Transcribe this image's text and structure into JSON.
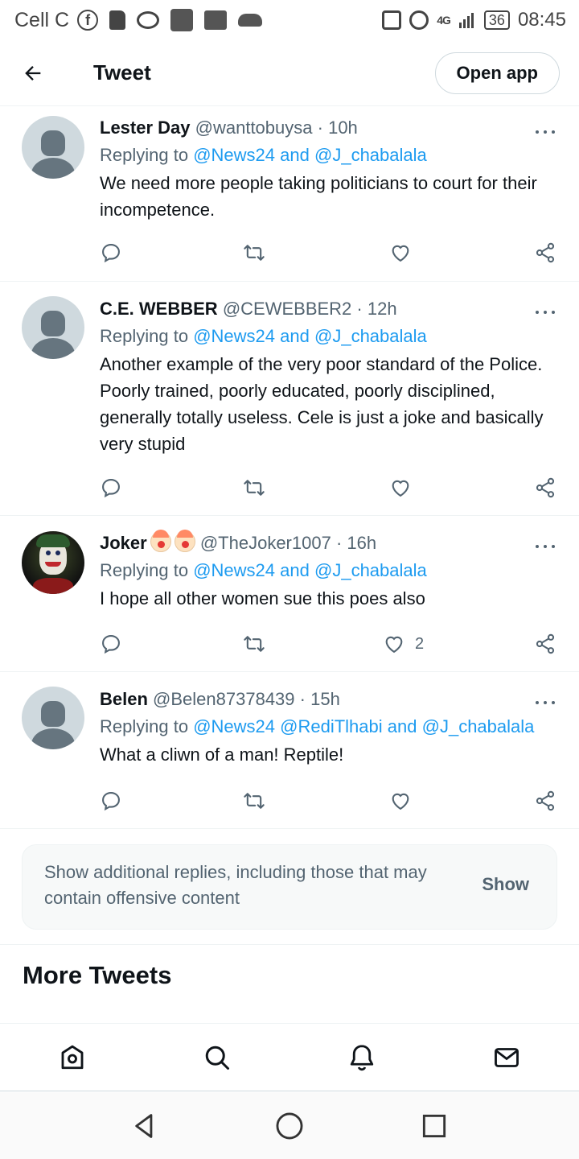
{
  "status_bar": {
    "carrier": "Cell C",
    "network": "4G",
    "battery": "36",
    "time": "08:45"
  },
  "header": {
    "title": "Tweet",
    "open_app_label": "Open app",
    "back_icon": "arrow-left-icon"
  },
  "tweets": [
    {
      "name": "Lester Day",
      "handle": "@wanttobuysa",
      "time": "10h",
      "replying_prefix": "Replying to",
      "mentions": [
        "@News24",
        "and",
        "@J_chabalala"
      ],
      "text": "We need more people taking politicians to court for their incompetence.",
      "likes": ""
    },
    {
      "name": "C.E. WEBBER",
      "handle": "@CEWEBBER2",
      "time": "12h",
      "replying_prefix": "Replying to",
      "mentions": [
        "@News24",
        "and",
        "@J_chabalala"
      ],
      "text": "Another example of the very poor standard of the Police. Poorly trained, poorly educated, poorly disciplined, generally totally useless. Cele is just a joke and basically very stupid",
      "likes": ""
    },
    {
      "name": "Joker",
      "handle": "@TheJoker1007",
      "time": "16h",
      "replying_prefix": "Replying to",
      "mentions": [
        "@News24",
        "and",
        "@J_chabalala"
      ],
      "text": "I hope all other women sue this poes also",
      "likes": "2"
    },
    {
      "name": "Belen",
      "handle": "@Belen87378439",
      "time": "15h",
      "replying_prefix": "Replying to",
      "mentions": [
        "@News24",
        "@RediTlhabi",
        "and",
        "@J_chabalala"
      ],
      "text": "What a cliwn of a man! Reptile!",
      "likes": ""
    }
  ],
  "separator": "·",
  "additional": {
    "text": "Show additional replies, including those that may contain offensive content",
    "button": "Show"
  },
  "more_tweets": "More Tweets",
  "colors": {
    "accent": "#1d9bf0",
    "text_primary": "#0f1419",
    "text_secondary": "#536471",
    "border": "#eff3f4"
  },
  "bottom_nav": [
    "home-icon",
    "search-icon",
    "notifications-bell-icon",
    "messages-envelope-icon"
  ],
  "android_nav": [
    "back-triangle-icon",
    "home-circle-icon",
    "recents-square-icon"
  ]
}
